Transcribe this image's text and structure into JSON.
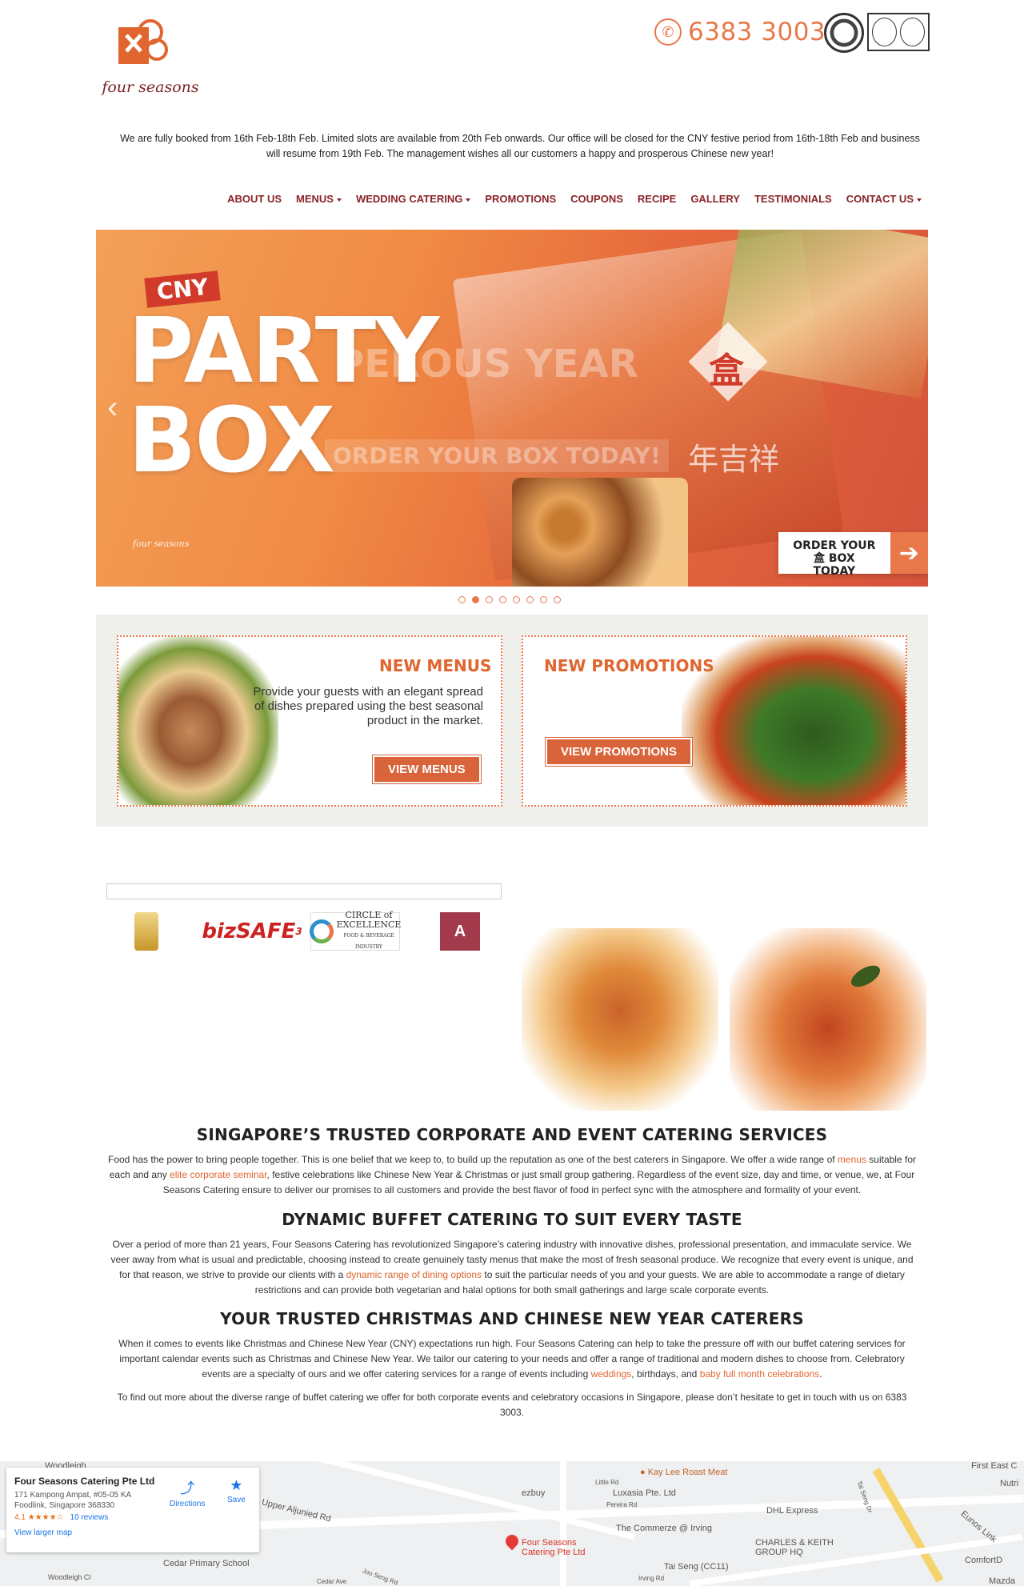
{
  "header": {
    "logo_text": "four seasons",
    "phone_number": "6383 3003",
    "phone_icon": "phone-icon"
  },
  "notice": "We are fully booked from 16th Feb-18th Feb. Limited slots are available from 20th Feb onwards. Our office will be closed for the CNY festive period from 16th-18th Feb and business will resume from 19th Feb. The management wishes all our customers a happy and prosperous Chinese new year!",
  "nav": {
    "items": [
      {
        "label": "ABOUT US",
        "dropdown": false
      },
      {
        "label": "MENUS",
        "dropdown": true
      },
      {
        "label": "WEDDING CATERING",
        "dropdown": true
      },
      {
        "label": "PROMOTIONS",
        "dropdown": false
      },
      {
        "label": "COUPONS",
        "dropdown": false
      },
      {
        "label": "RECIPE",
        "dropdown": false
      },
      {
        "label": "GALLERY",
        "dropdown": false
      },
      {
        "label": "TESTIMONIALS",
        "dropdown": false
      },
      {
        "label": "CONTACT US",
        "dropdown": true
      }
    ]
  },
  "hero": {
    "badge": "CNY",
    "title_line1": "PARTY",
    "title_line2": "BOX",
    "ghost_line1": "PEROUS YEAR",
    "ghost_line2": "ORDER YOUR BOX TODAY!",
    "chinese_char": "盒",
    "chinese_text": "年吉祥",
    "cta_line1": "ORDER YOUR",
    "cta_line2": "盒 BOX TODAY",
    "cta_arrow": "➔",
    "prev_arrow": "‹",
    "small_logo": "four seasons",
    "slide_count": 8,
    "active_slide": 2
  },
  "promo": {
    "menus": {
      "title": "NEW MENUS",
      "text": "Provide your guests with an elegant spread of dishes prepared using the best seasonal product in the market.",
      "button": "VIEW MENUS"
    },
    "promotions": {
      "title": "NEW PROMOTIONS",
      "button": "VIEW PROMOTIONS"
    }
  },
  "certs": {
    "bizsafe": "bizSAFE",
    "bizsafe_level": "3",
    "circle": "CIRCLE of EXCELLENCE",
    "circle_sub": "FOOD & BEVERAGE INDUSTRY",
    "award_letter": "A"
  },
  "sections": [
    {
      "title": "SINGAPORE’S TRUSTED CORPORATE AND EVENT CATERING SERVICES",
      "p1": "Food has the power to bring people together. This is one belief that we keep to, to build up the reputation as one of the best caterers in Singapore. We offer a wide range of ",
      "link1": "menus",
      "p2": " suitable for each and any ",
      "link2": "elite corporate seminar",
      "p3": ", festive celebrations like Chinese New Year & Christmas or just small group gathering. Regardless of the event size, day and time, or venue, we, at Four Seasons Catering ensure to deliver our promises to all customers and provide the best flavor of food in perfect sync with the atmosphere and formality of your event."
    },
    {
      "title": "DYNAMIC BUFFET CATERING TO SUIT EVERY TASTE",
      "p1": "Over a period of more than 21 years, Four Seasons Catering has revolutionized Singapore’s catering industry with innovative dishes, professional presentation, and immaculate service. We veer away from what is usual and predictable, choosing instead to create genuinely tasty menus that make the most of fresh seasonal produce. We recognize that every event is unique, and for that reason, we strive to provide our clients with a ",
      "link1": "dynamic range of dining options",
      "p2": " to suit the particular needs of you and your guests. We are able to accommodate a range of dietary restrictions and can provide both vegetarian and halal options for both small gatherings and large scale corporate events."
    },
    {
      "title": "YOUR TRUSTED CHRISTMAS AND CHINESE NEW YEAR CATERERS",
      "p1": "When it comes to events like Christmas and Chinese New Year (CNY) expectations run high. Four Seasons Catering can help to take the pressure off with our buffet catering services for important calendar events such as Christmas and Chinese New Year. We tailor our catering to your needs and offer a range of traditional and modern dishes to choose from. Celebratory events are a specialty of ours and we offer catering services for a range of events including ",
      "link1": "weddings",
      "p2": ", birthdays, and ",
      "link2": "baby full month celebrations",
      "p3": ".",
      "p4": "To find out more about the diverse range of buffet catering we offer for both corporate events and celebratory occasions in Singapore, please don’t hesitate to get in touch with us on 6383 3003."
    }
  ],
  "map": {
    "place_name": "Four Seasons Catering Pte Ltd",
    "address": "171 Kampong Ampat, #05-05 KA Foodlink, Singapore 368330",
    "rating": "4.1",
    "stars": "★★★★☆",
    "reviews": "10 reviews",
    "larger_map": "View larger map",
    "directions": "Directions",
    "save": "Save",
    "pin_label": "Four Seasons Catering Pte Ltd",
    "labels": {
      "woodleigh": "Woodleigh",
      "kay_lee": "Kay Lee Roast Meat",
      "ezbuy": "ezbuy",
      "luxasia": "Luxasia Pte. Ltd",
      "dhl": "DHL Express",
      "first_east": "First East C",
      "nutri": "Nutri",
      "upper_aljunied": "Upper Aljunied Rd",
      "commerze": "The Commerze @ Irving",
      "charles": "CHARLES & KEITH GROUP HQ",
      "tai_seng": "Tai Seng (CC11)",
      "cedar": "Cedar Primary School",
      "comfort": "ComfortD",
      "eunos": "Eunos Link",
      "mazda": "Mazda",
      "little_rd": "Little Rd",
      "pereira": "Pereira Rd",
      "woodleigh_cl": "Woodleigh Cl",
      "cedar_ave": "Cedar Ave",
      "joo_seng": "Joo Seng Rd",
      "irving": "Irving Rd",
      "tai_seng_dr": "Tai Seng Dr"
    }
  }
}
